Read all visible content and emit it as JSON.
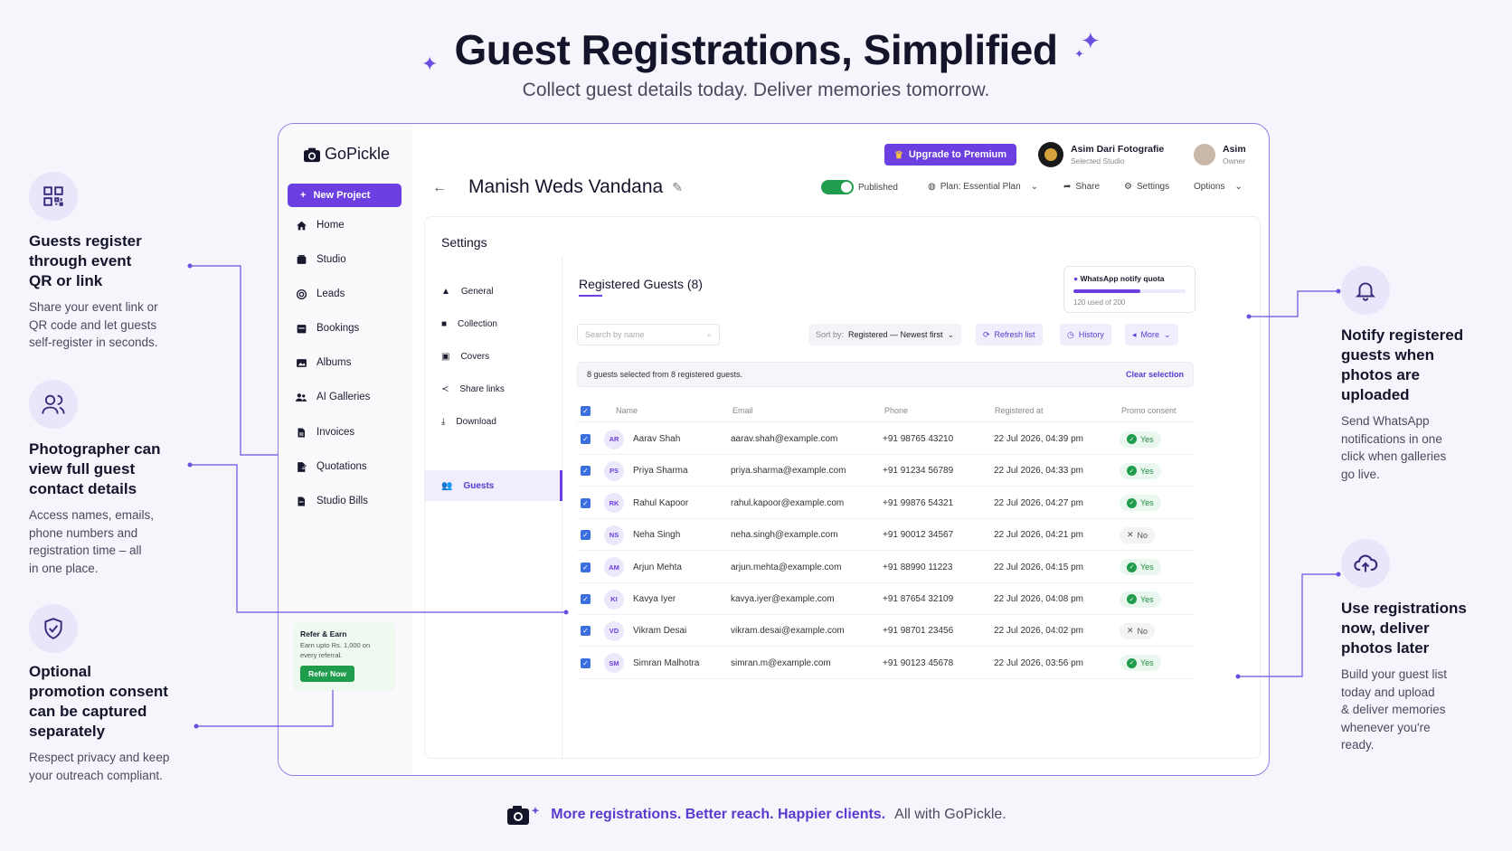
{
  "hero": {
    "title": "Guest Registrations, Simplified",
    "subtitle": "Collect guest details today. Deliver memories tomorrow."
  },
  "features_left": [
    {
      "icon": "qr-code-icon",
      "title_lines": [
        "Guests register",
        "through event",
        "QR or link"
      ],
      "desc_lines": [
        "Share your event link or",
        "QR code and let guests",
        "self-register in seconds."
      ]
    },
    {
      "icon": "users-icon",
      "title_lines": [
        "Photographer can",
        "view full guest",
        "contact details"
      ],
      "desc_lines": [
        "Access names, emails,",
        "phone numbers and",
        "registration time – all",
        "in one place."
      ]
    },
    {
      "icon": "shield-check-icon",
      "title_lines": [
        "Optional",
        "promotion consent",
        "can be captured",
        "separately"
      ],
      "desc_lines": [
        "Respect privacy and keep",
        "your outreach compliant."
      ]
    }
  ],
  "features_right": [
    {
      "icon": "bell-icon",
      "title_lines": [
        "Notify registered",
        "guests when",
        "photos are",
        "uploaded"
      ],
      "desc_lines": [
        "Send WhatsApp",
        "notifications in one",
        "click when galleries",
        "go live."
      ]
    },
    {
      "icon": "cloud-upload-icon",
      "title_lines": [
        "Use registrations",
        "now, deliver",
        "photos later"
      ],
      "desc_lines": [
        "Build your guest list",
        "today and upload",
        "& deliver memories",
        "whenever you're",
        "ready."
      ]
    }
  ],
  "app": {
    "logo": "GoPickle",
    "new_project": "New Project",
    "nav": [
      "Home",
      "Studio",
      "Leads",
      "Bookings",
      "Albums",
      "AI Galleries",
      "Invoices",
      "Quotations",
      "Studio Bills"
    ],
    "refer": {
      "title": "Refer & Earn",
      "desc_lines": [
        "Earn upto Rs. 1,000 on",
        "every referral."
      ],
      "button": "Refer Now"
    },
    "upgrade": "Upgrade to Premium",
    "studio": {
      "name": "Asim Dari Fotografie",
      "sub": "Selected Studio"
    },
    "user": {
      "name": "Asim",
      "role": "Owner"
    },
    "project_title": "Manish Weds Vandana",
    "toolbar": {
      "published": "Published",
      "plan": "Plan: Essential Plan",
      "share": "Share",
      "settings": "Settings",
      "options": "Options"
    },
    "settings_heading": "Settings",
    "sub_nav": [
      "General",
      "Collection",
      "Covers",
      "Share links",
      "Download",
      "Guests"
    ],
    "registered_heading": "Registered Guests (8)",
    "quota": {
      "title": "WhatsApp notify quota",
      "used_text": "120 used of 200",
      "used": 120,
      "total": 200
    },
    "search_placeholder": "Search by name",
    "sort": {
      "label": "Sort by:",
      "value": "Registered — Newest first"
    },
    "refresh": "Refresh list",
    "history": "History",
    "more": "More",
    "selection": {
      "text": "8 guests selected from 8 registered guests.",
      "clear": "Clear selection"
    },
    "columns": [
      "Name",
      "Email",
      "Phone",
      "Registered at",
      "Promo consent"
    ],
    "rows": [
      {
        "initials": "AR",
        "name": "Aarav Shah",
        "email": "aarav.shah@example.com",
        "phone": "+91 98765 43210",
        "registered": "22 Jul 2026, 04:39 pm",
        "consent": "Yes"
      },
      {
        "initials": "PS",
        "name": "Priya Sharma",
        "email": "priya.sharma@example.com",
        "phone": "+91 91234 56789",
        "registered": "22 Jul 2026, 04:33 pm",
        "consent": "Yes"
      },
      {
        "initials": "RK",
        "name": "Rahul Kapoor",
        "email": "rahul.kapoor@example.com",
        "phone": "+91 99876 54321",
        "registered": "22 Jul 2026, 04:27 pm",
        "consent": "Yes"
      },
      {
        "initials": "NS",
        "name": "Neha Singh",
        "email": "neha.singh@example.com",
        "phone": "+91 90012 34567",
        "registered": "22 Jul 2026, 04:21 pm",
        "consent": "No"
      },
      {
        "initials": "AM",
        "name": "Arjun Mehta",
        "email": "arjun.mehta@example.com",
        "phone": "+91 88990 11223",
        "registered": "22 Jul 2026, 04:15 pm",
        "consent": "Yes"
      },
      {
        "initials": "KI",
        "name": "Kavya Iyer",
        "email": "kavya.iyer@example.com",
        "phone": "+91 87654 32109",
        "registered": "22 Jul 2026, 04:08 pm",
        "consent": "Yes"
      },
      {
        "initials": "VD",
        "name": "Vikram Desai",
        "email": "vikram.desai@example.com",
        "phone": "+91 98701 23456",
        "registered": "22 Jul 2026, 04:02 pm",
        "consent": "No"
      },
      {
        "initials": "SM",
        "name": "Simran Malhotra",
        "email": "simran.m@example.com",
        "phone": "+91 90123 45678",
        "registered": "22 Jul 2026, 03:56 pm",
        "consent": "Yes"
      }
    ]
  },
  "footer": {
    "bold": "More registrations. Better reach. Happier clients.",
    "plain": "All with GoPickle."
  },
  "colors": {
    "accent": "#6c3fe0",
    "success": "#1f9d4c",
    "background": "#f6f5fc"
  }
}
